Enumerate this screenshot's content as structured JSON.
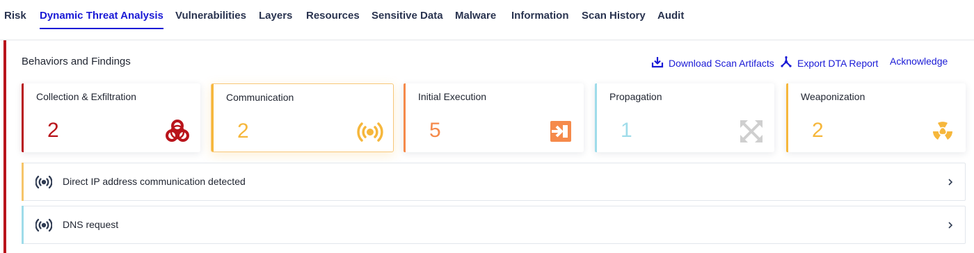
{
  "tabs": [
    {
      "label": "Risk",
      "active": false
    },
    {
      "label": "Dynamic Threat Analysis",
      "active": true
    },
    {
      "label": "Vulnerabilities",
      "active": false
    },
    {
      "label": "Layers",
      "active": false
    },
    {
      "label": "Resources",
      "active": false
    },
    {
      "label": "Sensitive Data",
      "active": false
    },
    {
      "label": "Malware",
      "active": false
    },
    {
      "label": "Information",
      "active": false
    },
    {
      "label": "Scan History",
      "active": false
    },
    {
      "label": "Audit",
      "active": false
    }
  ],
  "panel": {
    "title": "Behaviors and Findings",
    "severity_color": "#b9141b",
    "actions": {
      "download": {
        "label": "Download Scan Artifacts",
        "icon": "download-icon"
      },
      "export": {
        "label": "Export DTA Report",
        "icon": "export-report-icon"
      },
      "acknowledge": {
        "label": "Acknowledge"
      }
    }
  },
  "categories": [
    {
      "label": "Collection & Exfiltration",
      "count": "2",
      "color": "#b9141b",
      "icon": "biohazard-icon",
      "selected": false
    },
    {
      "label": "Communication",
      "count": "2",
      "color": "#f6b73c",
      "icon": "broadcast-icon",
      "selected": true
    },
    {
      "label": "Initial Execution",
      "count": "5",
      "color": "#f58a4b",
      "icon": "login-arrow-icon",
      "selected": false
    },
    {
      "label": "Propagation",
      "count": "1",
      "color": "#9fdcea",
      "icon": "expand-arrows-icon",
      "selected": false
    },
    {
      "label": "Weaponization",
      "count": "2",
      "color": "#f6b73c",
      "icon": "radiation-icon",
      "selected": false
    }
  ],
  "findings": [
    {
      "label": "Direct IP address communication detected",
      "color": "#f6c56a",
      "icon": "broadcast-icon"
    },
    {
      "label": "DNS request",
      "color": "#9fdcea",
      "icon": "broadcast-icon"
    }
  ],
  "colors": {
    "link": "#1a1ad6",
    "tab_text": "#2a3450",
    "icon_neutral": "#2f3b52",
    "propagation_icon": "#cfcfcf"
  }
}
